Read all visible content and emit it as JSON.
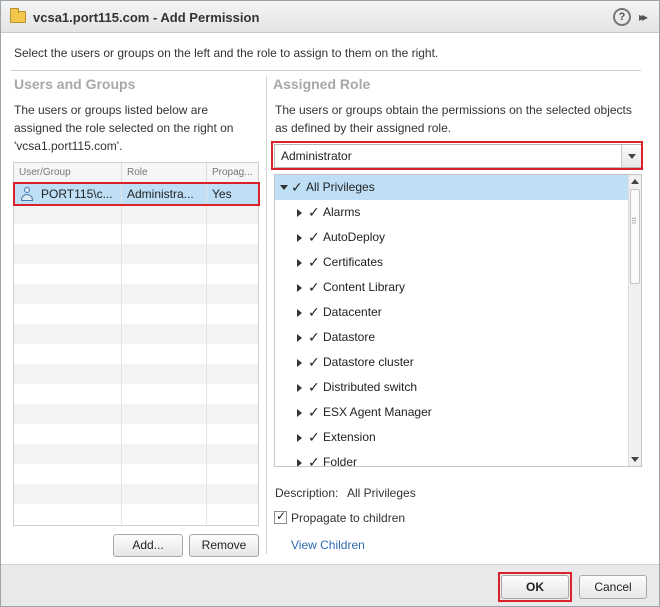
{
  "title_bar": {
    "title": "vcsa1.port115.com - Add Permission",
    "help_glyph": "?",
    "expand_glyph": "▸▸"
  },
  "intro": "Select the users or groups on the left and the role to assign to them on the right.",
  "users_groups": {
    "title": "Users and Groups",
    "description": "The users or groups listed below are assigned the role selected on the right on 'vcsa1.port115.com'.",
    "columns": [
      "User/Group",
      "Role",
      "Propag..."
    ],
    "rows": [
      {
        "user": "PORT115\\c...",
        "role": "Administra...",
        "propagate": "Yes"
      }
    ],
    "add_label": "Add...",
    "remove_label": "Remove"
  },
  "assigned_role": {
    "title": "Assigned Role",
    "description": "The users or groups obtain the permissions on the selected objects as defined by their assigned role.",
    "selected_role": "Administrator",
    "tree_root": "All Privileges",
    "tree_items": [
      "Alarms",
      "AutoDeploy",
      "Certificates",
      "Content Library",
      "Datacenter",
      "Datastore",
      "Datastore cluster",
      "Distributed switch",
      "ESX Agent Manager",
      "Extension",
      "Folder"
    ],
    "check_glyph": "✓",
    "description_label": "Description:",
    "description_value": "All Privileges",
    "propagate_label": "Propagate to children",
    "propagate_checked": true,
    "view_children_label": "View Children"
  },
  "footer": {
    "ok_label": "OK",
    "cancel_label": "Cancel"
  },
  "colors": {
    "highlight": "#bedff5",
    "annotation_red": "#d9212c",
    "link": "#2e6bb0",
    "section_title": "#a8a8a8"
  },
  "icons": [
    "folder-icon",
    "help-icon",
    "expand-icon",
    "user-icon",
    "check-icon",
    "expand-arrow-icon",
    "dropdown-arrow-icon"
  ]
}
